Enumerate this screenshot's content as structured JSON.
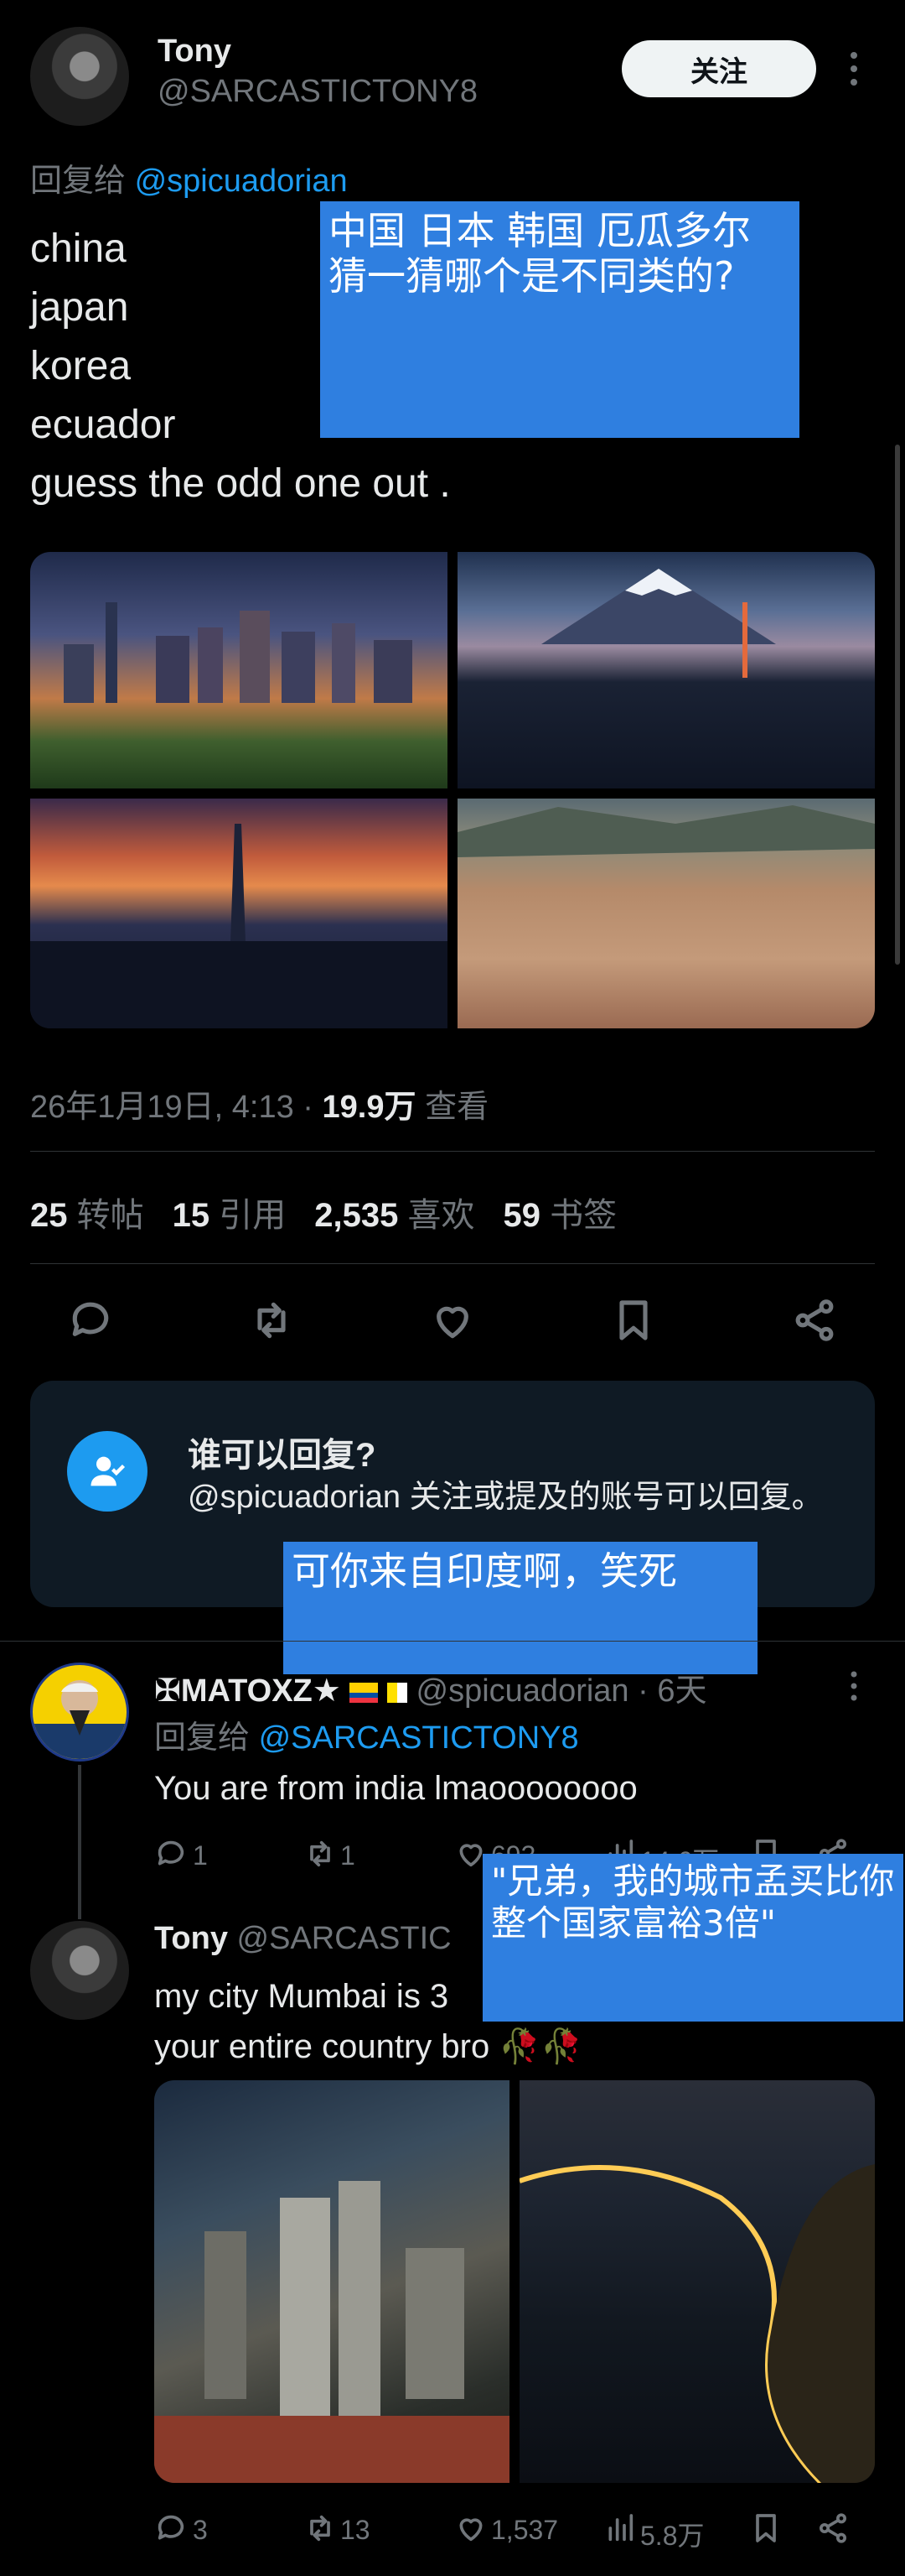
{
  "main_post": {
    "author_name": "Tony",
    "author_handle": "@SARCASTICTONY8",
    "follow_label": "关注",
    "more_icon": "more-vertical-icon",
    "reply_to_prefix": "回复给",
    "reply_to_handle": "@spicuadorian",
    "lines": [
      "china",
      "japan",
      "korea",
      "ecuador",
      "guess the odd one out ."
    ],
    "timestamp": "26年1月19日, 4:13 ·",
    "views_count": "19.9万",
    "views_label": "查看",
    "stats": [
      {
        "count": "25",
        "label": "转帖"
      },
      {
        "count": "15",
        "label": "引用"
      },
      {
        "count": "2,535",
        "label": "喜欢"
      },
      {
        "count": "59",
        "label": "书签"
      }
    ],
    "actions": [
      "reply-icon",
      "repost-icon",
      "like-icon",
      "bookmark-icon",
      "share-icon"
    ]
  },
  "translation_1": {
    "text": "中国 日本 韩国 厄瓜多尔\n猜一猜哪个是不同类的?"
  },
  "reply_restriction": {
    "title": "谁可以回复?",
    "text": "@spicuadorian 关注或提及的账号可以回复。"
  },
  "translation_2": {
    "text": "可你来自印度啊，笑死"
  },
  "reply_1": {
    "author_name": "✠MATOXZ★",
    "author_handle": "@spicuadorian",
    "time": "· 6天",
    "reply_to_prefix": "回复给",
    "reply_to_handle": "@SARCASTICTONY8",
    "text": "You are from india lmaoooooooo",
    "replies": "1",
    "reposts": "1",
    "likes": "693",
    "views": "14.6万"
  },
  "translation_3": {
    "text": "\"兄弟，我的城市孟买比你整个国家富裕3倍\""
  },
  "reply_2": {
    "author_name": "Tony",
    "author_handle": "@SARCASTIC",
    "text_line1": "my city Mumbai is 3",
    "text_line2": "your entire country bro 🥀🥀",
    "replies": "3",
    "reposts": "13",
    "likes": "1,537",
    "views": "5.8万"
  },
  "colors": {
    "accent": "#1d9bf0",
    "overlay": "#2f7fe0",
    "card": "#0f1a24"
  }
}
